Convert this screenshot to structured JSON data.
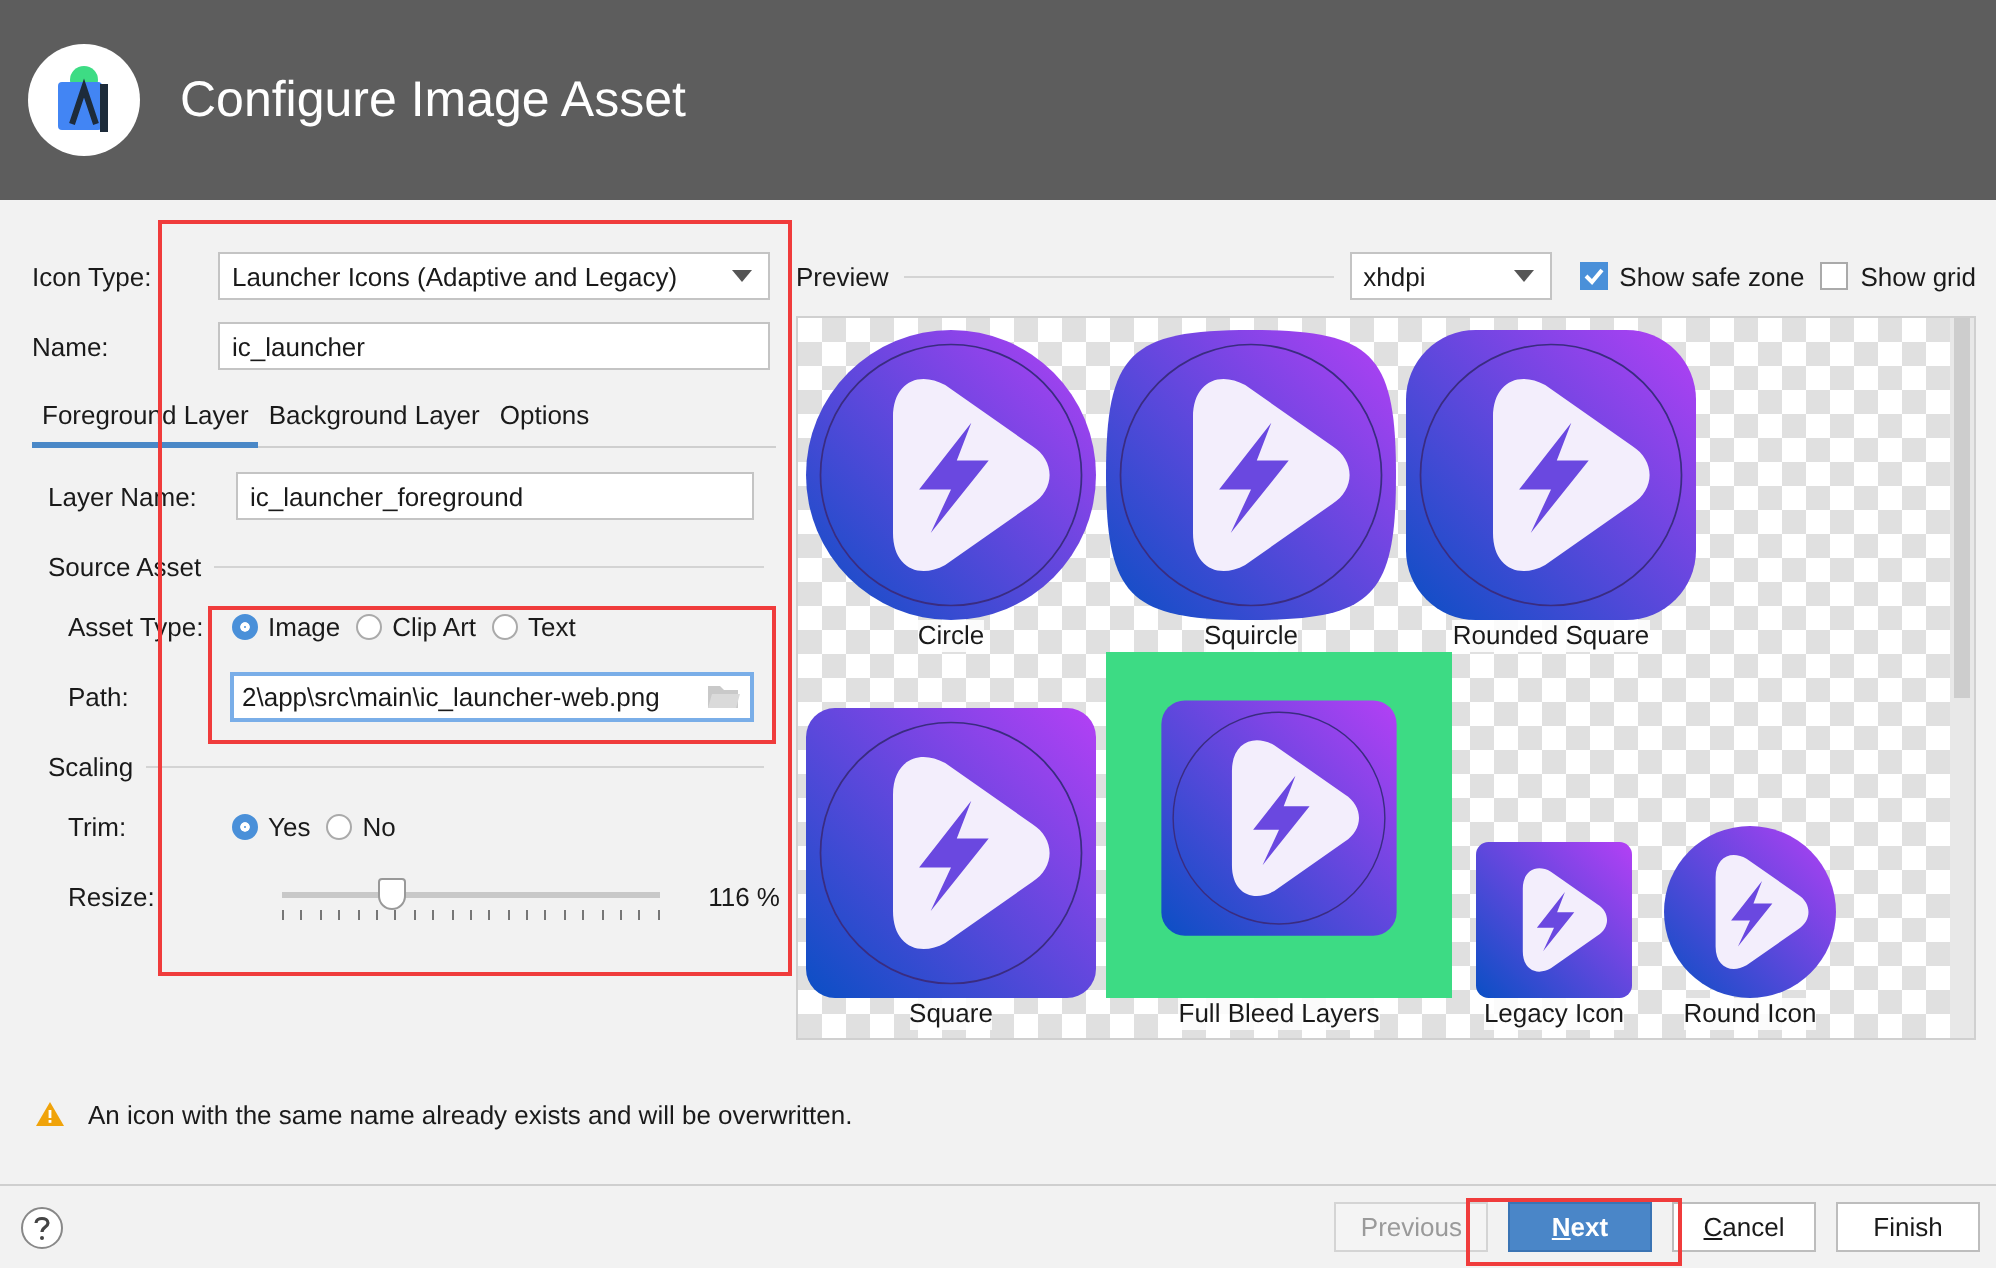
{
  "window": {
    "title": "Configure Image Asset"
  },
  "form": {
    "icon_type": {
      "label": "Icon Type:",
      "value": "Launcher Icons (Adaptive and Legacy)"
    },
    "name": {
      "label": "Name:",
      "value": "ic_launcher"
    }
  },
  "tabs": [
    {
      "label": "Foreground Layer",
      "selected": true
    },
    {
      "label": "Background Layer",
      "selected": false
    },
    {
      "label": "Options",
      "selected": false
    }
  ],
  "layer": {
    "label": "Layer Name:",
    "value": "ic_launcher_foreground"
  },
  "source_asset": {
    "title": "Source Asset",
    "asset_type_label": "Asset Type:",
    "asset_types": [
      {
        "label": "Image",
        "selected": true
      },
      {
        "label": "Clip Art",
        "selected": false
      },
      {
        "label": "Text",
        "selected": false
      }
    ],
    "path_label": "Path:",
    "path": "2\\app\\src\\main\\ic_launcher-web.png"
  },
  "scaling": {
    "title": "Scaling",
    "trim_label": "Trim:",
    "trim_options": [
      {
        "label": "Yes",
        "selected": true
      },
      {
        "label": "No",
        "selected": false
      }
    ],
    "resize_label": "Resize:",
    "resize": {
      "level": 0.29,
      "reading": "116 %"
    }
  },
  "preview": {
    "title": "Preview",
    "density": "xhdpi",
    "show_safe_zone": {
      "label": "Show safe zone",
      "checked": true
    },
    "show_grid": {
      "label": "Show grid",
      "checked": false
    },
    "icons": [
      {
        "label": "Circle",
        "kind": "circle"
      },
      {
        "label": "Squircle",
        "kind": "squircle"
      },
      {
        "label": "Rounded Square",
        "kind": "rounded"
      },
      {
        "label": "Square",
        "kind": "square"
      },
      {
        "label": "Full Bleed Layers",
        "kind": "fullbleed"
      },
      {
        "label": "Legacy Icon",
        "kind": "legacy"
      },
      {
        "label": "Round Icon",
        "kind": "round"
      }
    ]
  },
  "warning": "An icon with the same name already exists and will be overwritten.",
  "buttons": [
    {
      "label": "Previous",
      "disabled": true,
      "primary": false,
      "mnemonic": false
    },
    {
      "label": "Next",
      "disabled": false,
      "primary": true,
      "mnemonic": true
    },
    {
      "label": "Cancel",
      "disabled": false,
      "primary": false,
      "mnemonic": true
    },
    {
      "label": "Finish",
      "disabled": false,
      "primary": false,
      "mnemonic": false
    }
  ]
}
